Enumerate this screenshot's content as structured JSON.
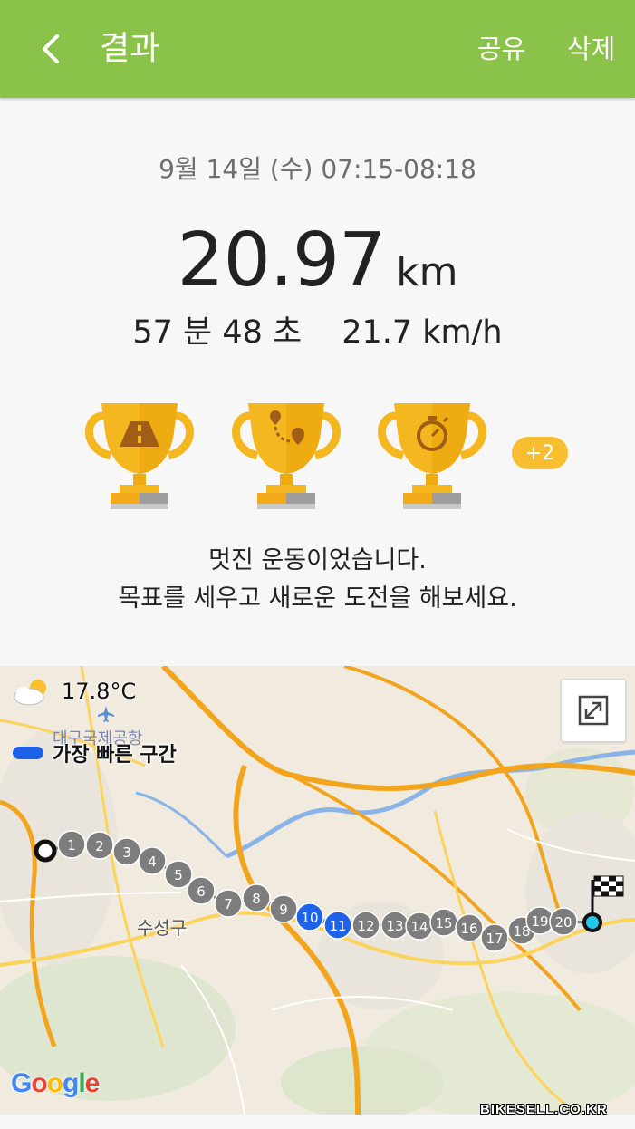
{
  "header": {
    "title": "결과",
    "share_label": "공유",
    "delete_label": "삭제",
    "background_color": "#8bc34a",
    "back_icon": "chevron-left-icon"
  },
  "summary": {
    "datetime": "9월 14일 (수) 07:15-08:18",
    "distance_value": "20.97",
    "distance_unit": "km",
    "duration": "57 분 48 초",
    "avg_speed": "21.7 km/h"
  },
  "trophies": {
    "items": [
      {
        "icon": "road-trophy-icon"
      },
      {
        "icon": "route-trophy-icon"
      },
      {
        "icon": "stopwatch-trophy-icon"
      }
    ],
    "more_badge": "+2",
    "trophy_color": "#f5b71f"
  },
  "message": {
    "line1": "멋진 운동이었습니다.",
    "line2": "목표를 세우고 새로운 도전을 해보세요."
  },
  "map": {
    "weather_temp": "17.8°C",
    "weather_icon": "partly-cloudy-icon",
    "legend_label": "가장 빠른 구간",
    "legend_color": "#1f62ea",
    "airport_label": "대구국제공항",
    "district_label": "수성구",
    "expand_icon": "expand-icon",
    "logo_text": "Google",
    "fastest_segments": [
      "10",
      "11"
    ],
    "splits": [
      "1",
      "2",
      "3",
      "4",
      "5",
      "6",
      "7",
      "8",
      "9",
      "10",
      "11",
      "12",
      "13",
      "14",
      "15",
      "16",
      "17",
      "18",
      "19",
      "20"
    ]
  },
  "watermark": "BIKESELL.CO.KR"
}
